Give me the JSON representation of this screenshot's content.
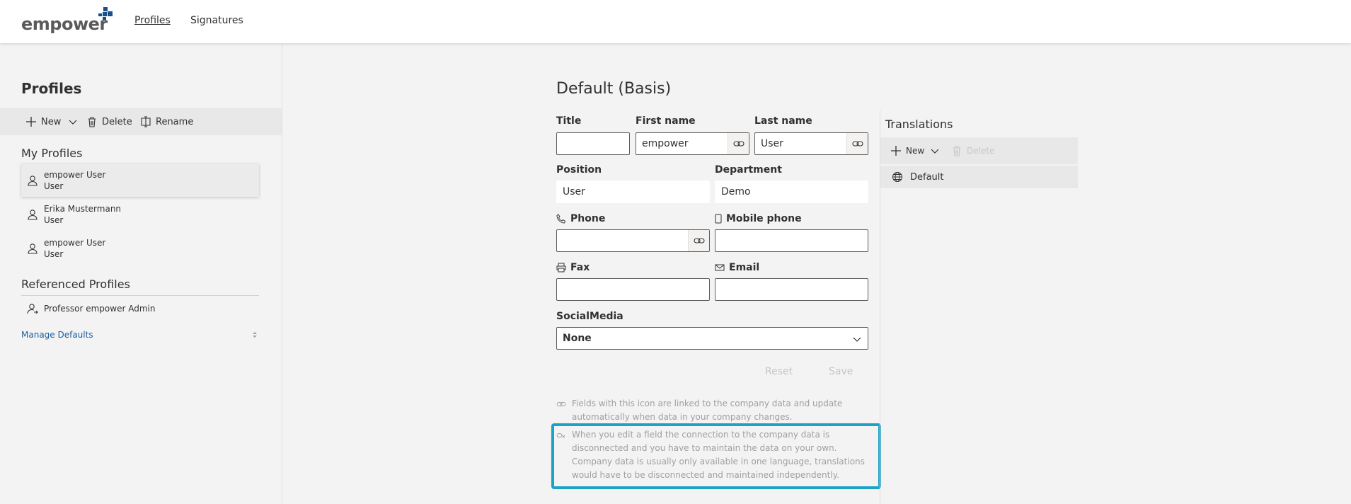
{
  "header": {
    "logo_text": "empower",
    "nav": [
      {
        "label": "Profiles",
        "active": true
      },
      {
        "label": "Signatures",
        "active": false
      }
    ]
  },
  "left": {
    "title": "Profiles",
    "toolbar": {
      "new": "New",
      "delete": "Delete",
      "rename": "Rename"
    },
    "my_profiles_heading": "My Profiles",
    "my_profiles": [
      {
        "name": "empower User",
        "role": "User",
        "selected": true
      },
      {
        "name": "Erika Mustermann",
        "role": "User",
        "selected": false
      },
      {
        "name": "empower User",
        "role": "User",
        "selected": false
      }
    ],
    "referenced_heading": "Referenced Profiles",
    "referenced": [
      {
        "name": "Professor empower Admin"
      }
    ],
    "manage_defaults": "Manage Defaults"
  },
  "form": {
    "title": "Default (Basis)",
    "fields": {
      "title": {
        "label": "Title",
        "value": ""
      },
      "first_name": {
        "label": "First name",
        "value": "empower"
      },
      "last_name": {
        "label": "Last name",
        "value": "User"
      },
      "position": {
        "label": "Position",
        "value": "User"
      },
      "department": {
        "label": "Department",
        "value": "Demo"
      },
      "phone": {
        "label": "Phone",
        "value": ""
      },
      "mobile": {
        "label": "Mobile phone",
        "value": ""
      },
      "fax": {
        "label": "Fax",
        "value": ""
      },
      "email": {
        "label": "Email",
        "value": ""
      },
      "social": {
        "label": "SocialMedia",
        "value": "None"
      }
    },
    "reset": "Reset",
    "save": "Save",
    "info_linked": "Fields with this icon are linked to the company data and update automatically when data in your company changes.",
    "info_unlinked": "When you edit a field the connection to the company data is disconnected and you have to maintain the data on your own. Company data is usually only available in one language, translations would have to be disconnected and maintained independently."
  },
  "translations": {
    "title": "Translations",
    "new": "New",
    "delete": "Delete",
    "items": [
      {
        "label": "Default"
      }
    ]
  },
  "colors": {
    "accent_highlight": "#1ba3c6",
    "link": "#1b5f9e",
    "logo_blue": "#1b4f8a"
  }
}
